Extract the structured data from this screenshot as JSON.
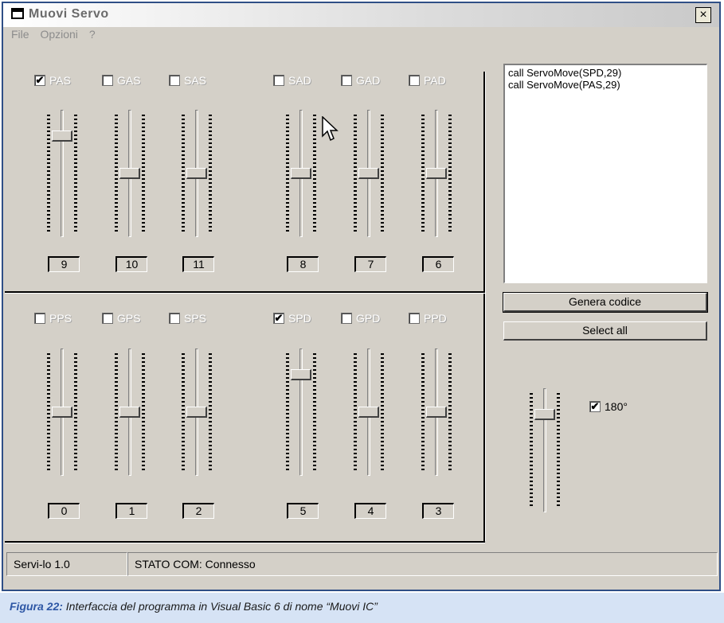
{
  "window": {
    "title": "Muovi Servo",
    "close_label": "×"
  },
  "menu": {
    "items": [
      "File",
      "Opzioni",
      "?"
    ]
  },
  "top_left_group": [
    {
      "label": "PAS",
      "checked": true,
      "value": "9",
      "level": 0.82
    },
    {
      "label": "GAS",
      "checked": false,
      "value": "10",
      "level": 0.5
    },
    {
      "label": "SAS",
      "checked": false,
      "value": "11",
      "level": 0.5
    }
  ],
  "top_right_group": [
    {
      "label": "SAD",
      "checked": false,
      "value": "8",
      "level": 0.5
    },
    {
      "label": "GAD",
      "checked": false,
      "value": "7",
      "level": 0.5
    },
    {
      "label": "PAD",
      "checked": false,
      "value": "6",
      "level": 0.5
    }
  ],
  "bottom_left_group": [
    {
      "label": "PPS",
      "checked": false,
      "value": "0",
      "level": 0.5
    },
    {
      "label": "GPS",
      "checked": false,
      "value": "1",
      "level": 0.5
    },
    {
      "label": "SPS",
      "checked": false,
      "value": "2",
      "level": 0.5
    }
  ],
  "bottom_right_group": [
    {
      "label": "SPD",
      "checked": true,
      "value": "5",
      "level": 0.82
    },
    {
      "label": "GPD",
      "checked": false,
      "value": "4",
      "level": 0.5
    },
    {
      "label": "PPD",
      "checked": false,
      "value": "3",
      "level": 0.5
    }
  ],
  "code_list": {
    "lines": [
      "call ServoMove(SPD,29)",
      "call ServoMove(PAS,29)"
    ]
  },
  "buttons": {
    "genera": "Genera codice",
    "select_all": "Select all"
  },
  "extra_slider": {
    "level": 0.82
  },
  "option_180": {
    "label": "180°",
    "checked": true
  },
  "status": {
    "version": "Servi-lo 1.0",
    "com_state": "STATO COM: Connesso"
  },
  "caption": {
    "lead": "Figura 22:",
    "text": "Interfaccia del programma in Visual Basic 6 di nome “Muovi IC”"
  }
}
